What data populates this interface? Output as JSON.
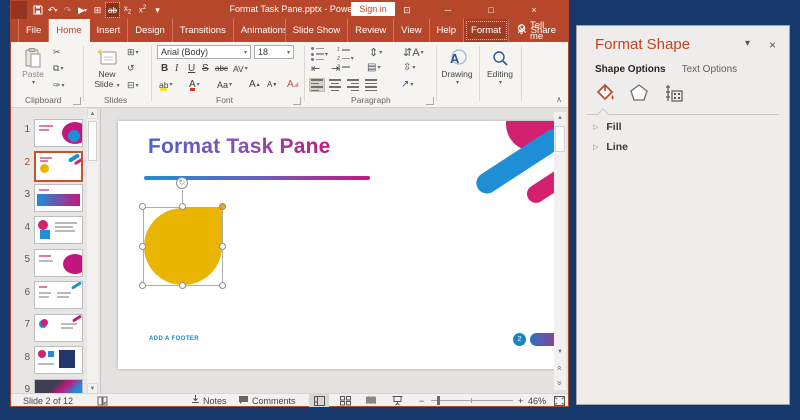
{
  "colors": {
    "accent": "#B7472A",
    "navy": "#17386A",
    "shape_yellow": "#E9B500",
    "deco_blue": "#1E8FD6",
    "deco_magenta": "#D4216F",
    "pane_title": "#C0441F"
  },
  "titlebar": {
    "title": "Format Task Pane.pptx - Power...",
    "sign_in": "Sign in"
  },
  "tabs": {
    "items": [
      "File",
      "Home",
      "Insert",
      "Design",
      "Transitions",
      "Animations",
      "Slide Show",
      "Review",
      "View",
      "Help",
      "Format"
    ],
    "tell_me": "Tell me",
    "share": "Share"
  },
  "ribbon": {
    "clipboard": {
      "label": "Clipboard",
      "paste": "Paste"
    },
    "slides": {
      "label": "Slides",
      "new_slide_line1": "New",
      "new_slide_line2": "Slide"
    },
    "font": {
      "label": "Font",
      "font_name": "Arial (Body)",
      "font_size": "18",
      "bold": "B",
      "italic": "I",
      "underline": "U",
      "strike": "S",
      "clearx": "abc",
      "spacing": "AV",
      "case": "Aa",
      "color_a": "A",
      "grow": "A",
      "shrink": "A"
    },
    "paragraph": {
      "label": "Paragraph"
    },
    "drawing": "Drawing",
    "editing": "Editing"
  },
  "thumbnails": {
    "nums": [
      "1",
      "2",
      "3",
      "4",
      "5",
      "6",
      "7",
      "8",
      "9"
    ],
    "selected": "2"
  },
  "slide": {
    "title": "Format Task Pane",
    "footer": "ADD A FOOTER",
    "page_number": "2"
  },
  "status": {
    "slide_counter": "Slide 2 of 12",
    "notes": "Notes",
    "comments": "Comments",
    "zoom": "46%"
  },
  "pane": {
    "title": "Format Shape",
    "tab_shape": "Shape Options",
    "tab_text": "Text Options",
    "fill": "Fill",
    "line": "Line"
  },
  "icons": {
    "undo": "↶",
    "redo": "↷",
    "start_show": "▶",
    "grid": "⊞",
    "qat_dd": "▾",
    "ribbon_options": "⊡",
    "minimize": "─",
    "restore": "□",
    "close": "×",
    "cut": "✂",
    "copy": "⧉",
    "painter": "✑",
    "layout": "⊞",
    "reset": "↺",
    "section": "⊟",
    "dd": "▾",
    "line_spacing": "⇕",
    "text_dir": "⇵",
    "indent_dec": "⇤",
    "indent_inc": "⇥",
    "columns": "▤",
    "align_text": "⇳",
    "smartart": "↗",
    "collapse": "∧",
    "up": "▲",
    "down": "▼",
    "prev": "«",
    "next": "»",
    "rotate": "↻",
    "zoom_minus": "−",
    "zoom_plus": "+",
    "expand_tri": "▷",
    "pane_dd": "▾",
    "pane_close": "×"
  }
}
